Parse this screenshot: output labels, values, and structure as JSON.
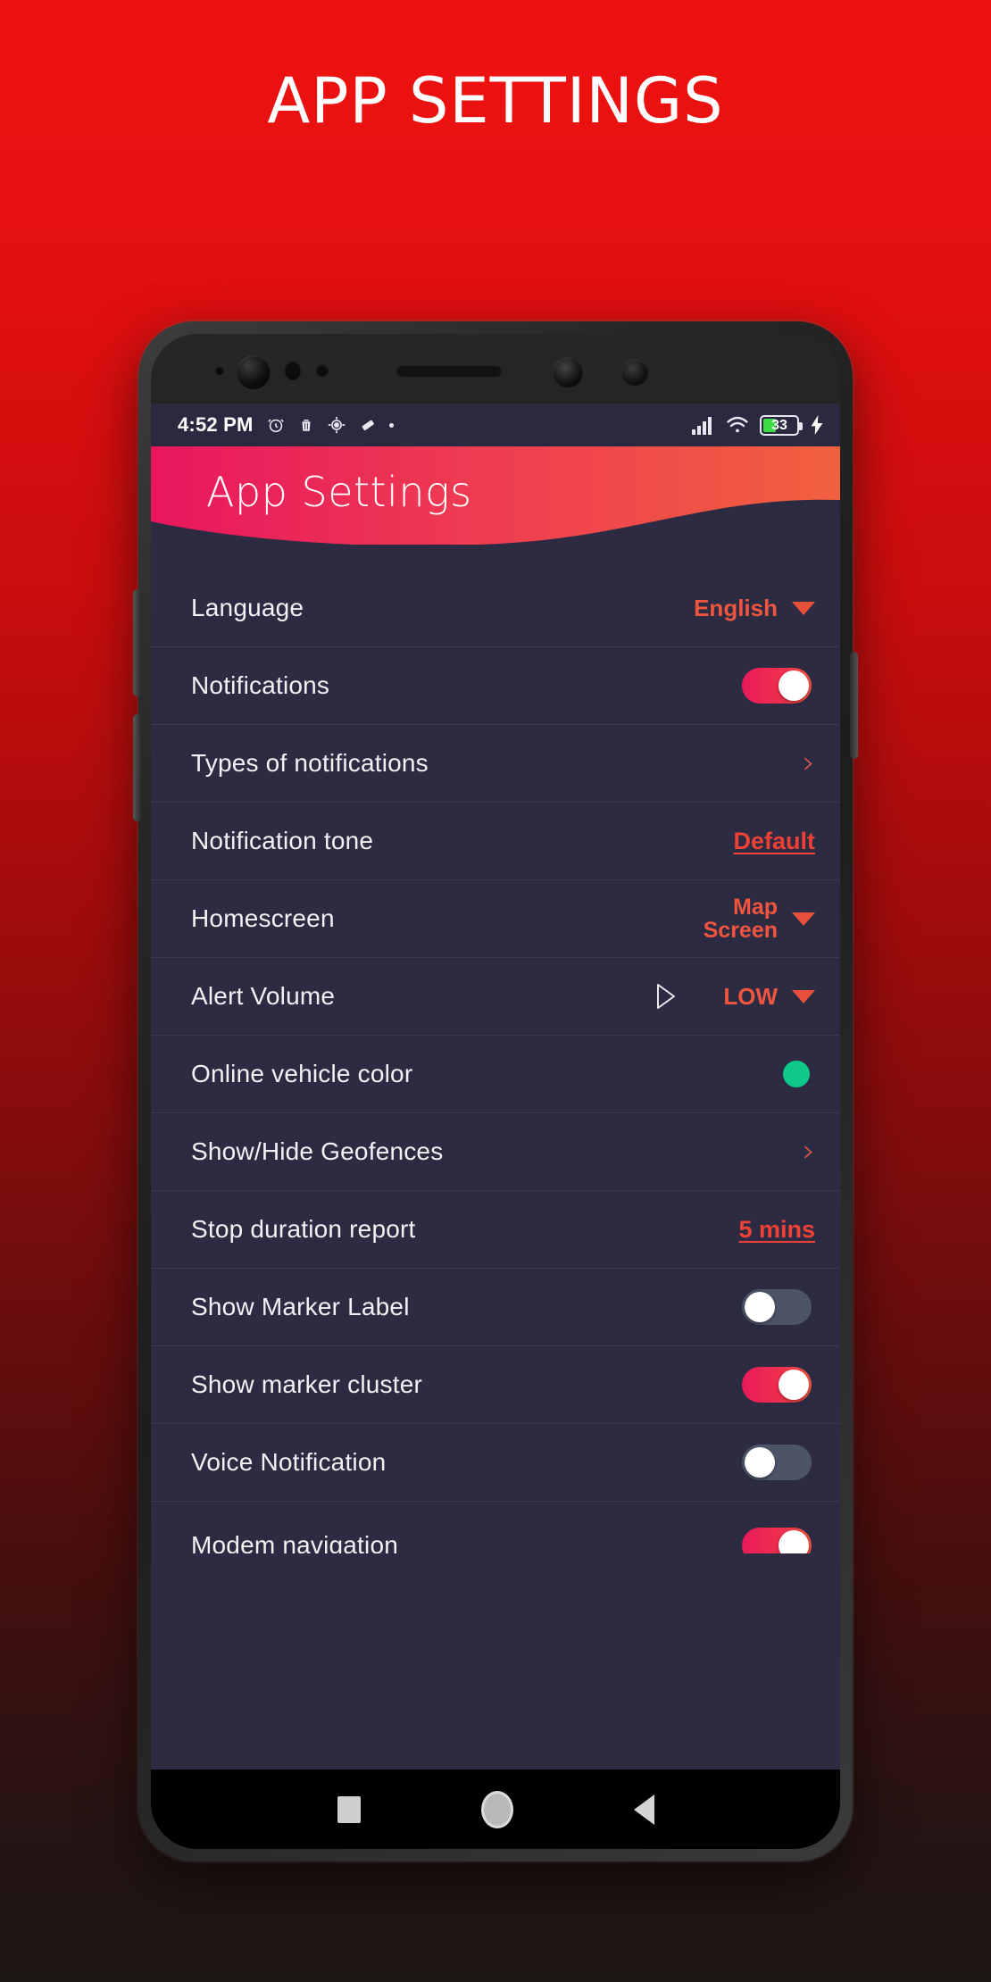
{
  "poster": {
    "title": "APP SETTINGS",
    "background_top_color": "#ef1212",
    "background_bottom_color": "#1b1514"
  },
  "status_bar": {
    "time": "4:52 PM",
    "left_icons": [
      "alarm-clock-icon",
      "trash-icon",
      "location-target-icon",
      "eraser-icon",
      "tiny-dot-icon"
    ],
    "signal_icon": "signal-bars-icon",
    "wifi_icon": "wifi-icon",
    "battery_level": "33",
    "battery_fill_color": "#3ddc45",
    "charging_icon": "lightning-bolt-icon"
  },
  "app_header": {
    "title": "App Settings",
    "gradient_start": "#e8165e",
    "gradient_end": "#f2603f"
  },
  "theme": {
    "screen_bg": "#2c2b42",
    "accent": "#f0553f",
    "accent_underline": "#ef4136",
    "toggle_on_start": "#e81a5a",
    "toggle_on_end": "#f3553f",
    "toggle_off": "#4c5568",
    "online_color_swatch": "#0ec98a"
  },
  "settings": {
    "rows": [
      {
        "label": "Language",
        "type": "dropdown",
        "value": "English",
        "icon": "chevron-down-icon"
      },
      {
        "label": "Notifications",
        "type": "toggle",
        "value": "on",
        "icon": "toggle-switch"
      },
      {
        "label": "Types of notifications",
        "type": "link",
        "value": "›",
        "icon": "chevron-right-icon"
      },
      {
        "label": "Notification tone",
        "type": "underlined",
        "value": "Default",
        "icon": "none"
      },
      {
        "label": "Homescreen",
        "type": "dropdown2",
        "value": "Map\nScreen",
        "value_line1": "Map",
        "value_line2": "Screen",
        "icon": "chevron-down-icon"
      },
      {
        "label": "Alert Volume",
        "type": "dropdown-play",
        "value": "LOW",
        "icon": "play-icon"
      },
      {
        "label": "Online vehicle color",
        "type": "color",
        "value": "#0ec98a",
        "icon": "color-swatch"
      },
      {
        "label": "Show/Hide Geofences",
        "type": "link",
        "value": "›",
        "icon": "chevron-right-icon"
      },
      {
        "label": "Stop duration report",
        "type": "underlined",
        "value": "5 mins",
        "icon": "none"
      },
      {
        "label": "Show Marker Label",
        "type": "toggle",
        "value": "off",
        "icon": "toggle-switch"
      },
      {
        "label": "Show marker cluster",
        "type": "toggle",
        "value": "on",
        "icon": "toggle-switch"
      },
      {
        "label": "Voice Notification",
        "type": "toggle",
        "value": "off",
        "icon": "toggle-switch"
      },
      {
        "label": "Modem navigation",
        "type": "toggle",
        "value": "on",
        "icon": "toggle-switch"
      }
    ]
  },
  "nav_bar": {
    "recents_label": "recents-square-icon",
    "home_label": "home-circle-icon",
    "back_label": "back-triangle-icon"
  }
}
